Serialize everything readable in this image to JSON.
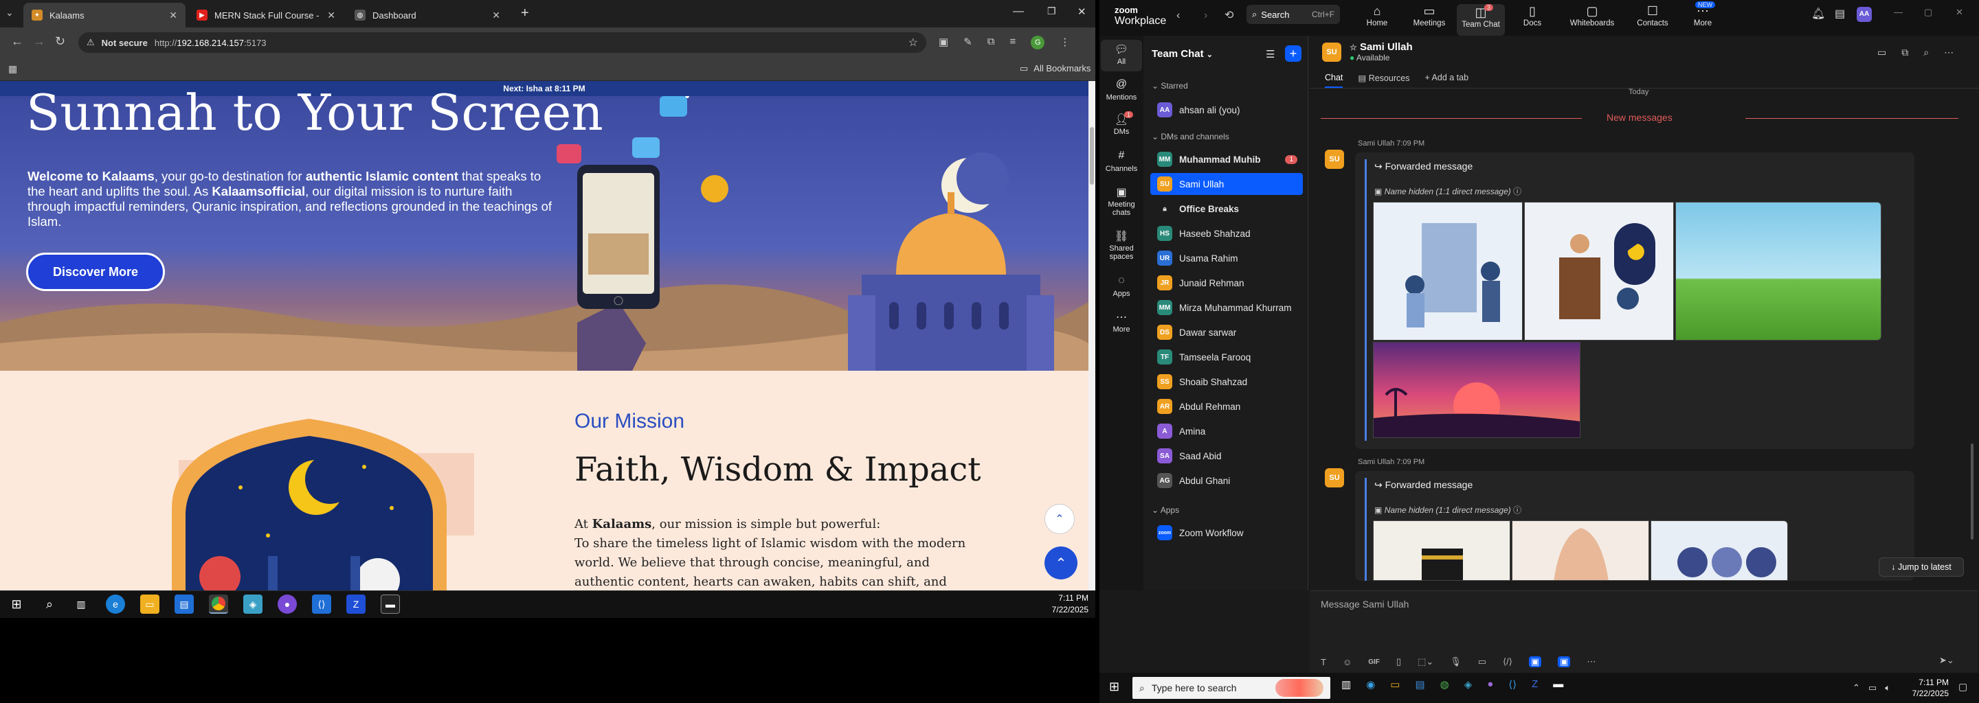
{
  "browser": {
    "tabs": [
      {
        "title": "Kalaams",
        "active": true
      },
      {
        "title": "MERN Stack Full Course - ECom",
        "active": false
      },
      {
        "title": "Dashboard",
        "active": false
      }
    ],
    "security": "Not secure",
    "url_prefix": "http://",
    "url_host": "192.168.214.157",
    "url_port": ":5173",
    "bookmarks_label": "All Bookmarks"
  },
  "site": {
    "announcement": "Next: Isha at 8:11 PM",
    "hero_title": "Sunnah to Your Screen",
    "hero_desc_1": "Welcome to Kalaams",
    "hero_desc_2": ", your go-to destination for ",
    "hero_desc_3": "authentic Islamic content",
    "hero_desc_4": " that speaks to the heart and uplifts the soul. As ",
    "hero_desc_5": "Kalaamsofficial",
    "hero_desc_6": ", our digital mission is to nurture faith through impactful reminders, Quranic inspiration, and reflections grounded in the teachings of Islam.",
    "cta": "Discover More",
    "mission_label": "Our Mission",
    "mission_title": "Faith, Wisdom & Impact",
    "mission_p1a": "At ",
    "mission_p1b": "Kalaams",
    "mission_p1c": ", our mission is simple but powerful:",
    "mission_p2": "To share the timeless light of Islamic wisdom with the modern world. We believe that through concise, meaningful, and authentic content, hearts can awaken, habits can shift, and lives"
  },
  "taskbar_left": {
    "time": "7:11 PM",
    "date": "7/22/2025"
  },
  "zoom": {
    "logo_top": "zoom",
    "logo_bottom": "Workplace",
    "search_label": "Search",
    "search_shortcut": "Ctrl+F",
    "nav": [
      {
        "label": "Home",
        "icon": "home-icon"
      },
      {
        "label": "Meetings",
        "icon": "video-icon"
      },
      {
        "label": "Team Chat",
        "icon": "chat-icon",
        "badge": "3"
      },
      {
        "label": "Docs",
        "icon": "doc-icon"
      },
      {
        "label": "Whiteboards",
        "icon": "whiteboard-icon"
      },
      {
        "label": "Contacts",
        "icon": "contacts-icon"
      },
      {
        "label": "More",
        "icon": "more-icon",
        "tag": "NEW"
      }
    ],
    "avatar_initials": "AA",
    "rail": [
      {
        "label": "All"
      },
      {
        "label": "Mentions"
      },
      {
        "label": "DMs",
        "badge": "1"
      },
      {
        "label": "Channels"
      },
      {
        "label": "Meeting chats"
      },
      {
        "label": "Shared spaces"
      },
      {
        "label": "Apps"
      },
      {
        "label": "More"
      }
    ],
    "panel_title": "Team Chat",
    "sections": {
      "starred": "Starred",
      "dms": "DMs and channels",
      "apps": "Apps"
    },
    "starred": [
      {
        "initials": "AA",
        "name": "ahsan ali (you)",
        "color": "#6b5bd6"
      }
    ],
    "contacts": [
      {
        "initials": "MM",
        "name": "Muhammad Muhib",
        "color": "#2a8a7a",
        "bold": true,
        "badge": "1"
      },
      {
        "initials": "SU",
        "name": "Sami Ullah",
        "color": "#f0a020",
        "selected": true
      },
      {
        "initials": "",
        "name": "Office Breaks",
        "color": "#1c1c1c",
        "bold": true,
        "lock": true
      },
      {
        "initials": "HS",
        "name": "Haseeb Shahzad",
        "color": "#2a8a7a"
      },
      {
        "initials": "UR",
        "name": "Usama Rahim",
        "color": "#2a6fd6"
      },
      {
        "initials": "JR",
        "name": "Junaid Rehman",
        "color": "#f0a020"
      },
      {
        "initials": "MM",
        "name": "Mirza Muhammad Khurram",
        "color": "#2a8a7a"
      },
      {
        "initials": "DS",
        "name": "Dawar sarwar",
        "color": "#f0a020"
      },
      {
        "initials": "TF",
        "name": "Tamseela Farooq",
        "color": "#2a8a7a"
      },
      {
        "initials": "SS",
        "name": "Shoaib Shahzad",
        "color": "#f0a020"
      },
      {
        "initials": "AR",
        "name": "Abdul Rehman",
        "color": "#f0a020"
      },
      {
        "initials": "A",
        "name": "Amina",
        "color": "#8b5bd6"
      },
      {
        "initials": "SA",
        "name": "Saad Abid",
        "color": "#8b5bd6"
      },
      {
        "initials": "AG",
        "name": "Abdul Ghani",
        "color": "#555"
      }
    ],
    "apps": [
      {
        "initials": "zoom",
        "name": "Zoom Workflow",
        "color": "#0b5cff"
      }
    ],
    "chat_header": {
      "initials": "SU",
      "name": "Sami Ullah",
      "status": "Available"
    },
    "chat_tabs": [
      "Chat",
      "Resources",
      "Add a tab"
    ],
    "day_label": "Today",
    "new_messages": "New messages",
    "messages": [
      {
        "sender": "Sami Ullah",
        "time": "7:09 PM",
        "forward_label": "Forwarded message",
        "hidden_label": "Name hidden (1:1 direct message)"
      },
      {
        "sender": "Sami Ullah",
        "time": "7:09 PM",
        "forward_label": "Forwarded message",
        "hidden_label": "Name hidden (1:1 direct message)"
      }
    ],
    "jump_latest": "Jump to latest",
    "compose_placeholder": "Message Sami Ullah",
    "gif_label": "GIF"
  },
  "taskbar_right": {
    "search_placeholder": "Type here to search",
    "time": "7:11 PM",
    "date": "7/22/2025"
  },
  "colors": {
    "zoom_blue": "#0b5cff",
    "new_messages": "#e15b5b",
    "cta_blue": "#1f3fd6"
  }
}
